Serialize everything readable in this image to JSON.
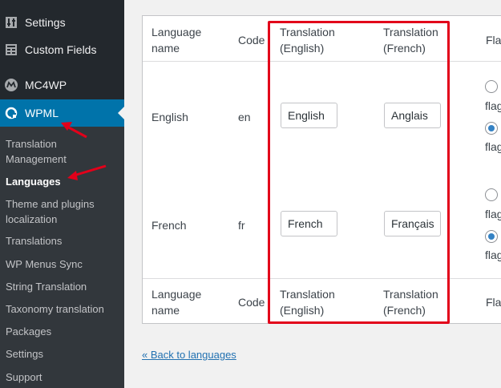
{
  "sidebar": {
    "menu": [
      {
        "label": "Settings",
        "icon": "settings-sliders-icon"
      },
      {
        "label": "Custom Fields",
        "icon": "custom-fields-icon"
      },
      {
        "label": "MC4WP",
        "icon": "mc4wp-icon"
      },
      {
        "label": "WPML",
        "icon": "wpml-icon"
      }
    ],
    "submenu": [
      "Translation Management",
      "Languages",
      "Theme and plugins localization",
      "Translations",
      "WP Menus Sync",
      "String Translation",
      "Taxonomy translation",
      "Packages",
      "Settings",
      "Support"
    ]
  },
  "table": {
    "headers": {
      "language_name": "Language name",
      "code": "Code",
      "translation_english": "Translation (English)",
      "translation_french": "Translation (French)",
      "flag": "Flag"
    },
    "rows": [
      {
        "name": "English",
        "code": "en",
        "translation_english": "English",
        "translation_french": "Anglais",
        "flag_label": "flag"
      },
      {
        "name": "French",
        "code": "fr",
        "translation_english": "French",
        "translation_french": "Français",
        "flag_label": "flag"
      }
    ]
  },
  "back_link": "« Back to languages",
  "colors": {
    "accent": "#0073aa",
    "highlight": "#e2001a",
    "link": "#2271b1"
  }
}
